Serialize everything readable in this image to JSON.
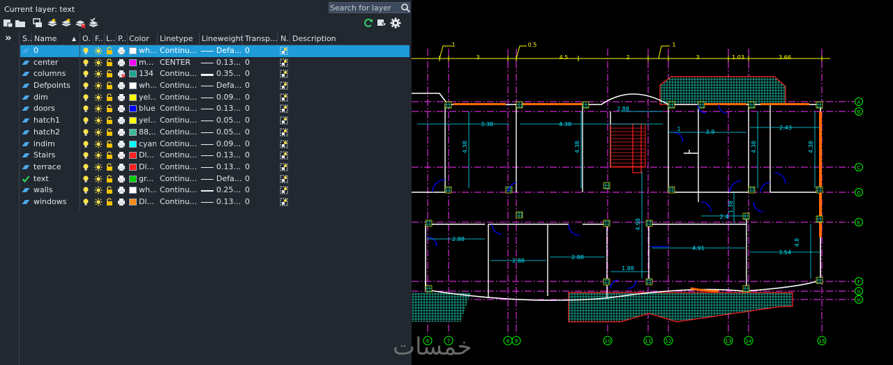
{
  "palette": {
    "current_layer": "Current layer: text",
    "search_placeholder": "Search for layer"
  },
  "columns": {
    "status": "S..",
    "name": "Name",
    "on": "O..",
    "freeze": "F...",
    "lock": "L...",
    "plot": "P...",
    "color": "Color",
    "linetype": "Linetype",
    "lineweight": "Lineweight",
    "transparency": "Transp...",
    "new_vp": "N..",
    "description": "Description"
  },
  "layers": [
    {
      "name": "0",
      "color": "wh...",
      "swatch": "#ffffff",
      "linetype": "Continu...",
      "lineweight": "Defa...",
      "lwthick": 1,
      "transparency": "0",
      "status": "layer",
      "selected": true
    },
    {
      "name": "center",
      "color": "m...",
      "swatch": "#ff00ff",
      "linetype": "CENTER",
      "lineweight": "0.13...",
      "lwthick": 1,
      "transparency": "0",
      "status": "layer"
    },
    {
      "name": "columns",
      "color": "134",
      "swatch": "#1aa58f",
      "linetype": "Continu...",
      "lineweight": "0.35...",
      "lwthick": 3,
      "transparency": "0",
      "status": "layer",
      "plot_off": true
    },
    {
      "name": "Defpoints",
      "color": "wh...",
      "swatch": "#ffffff",
      "linetype": "Continu...",
      "lineweight": "Defa...",
      "lwthick": 1,
      "transparency": "0",
      "status": "layer"
    },
    {
      "name": "dim",
      "color": "yel...",
      "swatch": "#ffff00",
      "linetype": "Continu...",
      "lineweight": "0.09...",
      "lwthick": 1,
      "transparency": "0",
      "status": "layer"
    },
    {
      "name": "doors",
      "color": "blue",
      "swatch": "#0000ff",
      "linetype": "Continu...",
      "lineweight": "0.13...",
      "lwthick": 1,
      "transparency": "0",
      "status": "layer"
    },
    {
      "name": "hatch1",
      "color": "yel...",
      "swatch": "#ffff00",
      "linetype": "Continu...",
      "lineweight": "0.05...",
      "lwthick": 1,
      "transparency": "0",
      "status": "layer"
    },
    {
      "name": "hatch2",
      "color": "88,...",
      "swatch": "#3fba94",
      "linetype": "Continu...",
      "lineweight": "0.05...",
      "lwthick": 1,
      "transparency": "0",
      "status": "layer"
    },
    {
      "name": "indim",
      "color": "cyan",
      "swatch": "#00ffff",
      "linetype": "Continu...",
      "lineweight": "0.09...",
      "lwthick": 1,
      "transparency": "0",
      "status": "layer"
    },
    {
      "name": "Stairs",
      "color": "Dl...",
      "swatch": "#ff2020",
      "linetype": "Continu...",
      "lineweight": "0.13...",
      "lwthick": 1,
      "transparency": "0",
      "status": "layer"
    },
    {
      "name": "terrace",
      "color": "Dl...",
      "swatch": "#ff2020",
      "linetype": "Continu...",
      "lineweight": "0.13...",
      "lwthick": 1,
      "transparency": "0",
      "status": "layer"
    },
    {
      "name": "text",
      "color": "gr...",
      "swatch": "#00cc00",
      "linetype": "Continu...",
      "lineweight": "Defa...",
      "lwthick": 1,
      "transparency": "0",
      "status": "current"
    },
    {
      "name": "walls",
      "color": "wh...",
      "swatch": "#ffffff",
      "linetype": "Continu...",
      "lineweight": "0.25...",
      "lwthick": 2,
      "transparency": "0",
      "status": "layer"
    },
    {
      "name": "windows",
      "color": "Dl...",
      "swatch": "#ff8c1a",
      "linetype": "Continu...",
      "lineweight": "0.13...",
      "lwthick": 1,
      "transparency": "0",
      "status": "layer"
    }
  ],
  "drawing": {
    "top_dims": [
      "1",
      "3",
      "0.5",
      "4.5",
      "2",
      "1",
      "3",
      "1.03",
      "3.66"
    ],
    "room_dims": [
      "3.38",
      "4.38",
      "2.88",
      "3.9",
      "2.43",
      "4.38",
      "4.38",
      "4.38",
      "4.38",
      "2.4",
      "1.38",
      "2.88",
      "2.88",
      "2.88",
      "4.98",
      "4.91",
      "3.54",
      "4.8",
      "1.88",
      "1"
    ],
    "row_axes": [
      "A",
      "B",
      "C",
      "D",
      "E",
      "F",
      "G",
      "H"
    ],
    "col_axes": [
      "6",
      "7",
      "8",
      "9",
      "10",
      "11",
      "12",
      "13",
      "14",
      "15"
    ],
    "colors": {
      "grid": "#ff33ff",
      "walls": "#ffffff",
      "dims": "#00e5ff",
      "axis": "#00ff00",
      "hatch": "#1aa58f",
      "terrace": "#ff2020",
      "windows": "#ff6a00",
      "doors": "#0000ff",
      "labels": "#ffff00"
    }
  },
  "watermark": "خمسات"
}
